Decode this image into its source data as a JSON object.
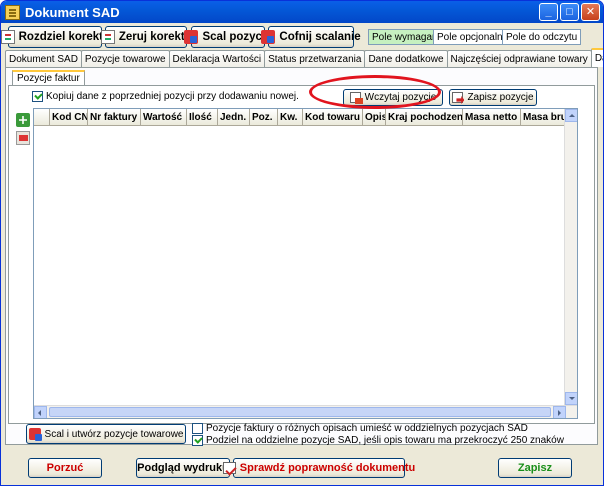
{
  "window": {
    "title": "Dokument SAD"
  },
  "toolbar": {
    "rozdziel": "Rozdziel korektę",
    "zeruj": "Zeruj korekty",
    "scal": "Scal pozycje",
    "cofnij": "Cofnij scalanie"
  },
  "legend": {
    "wymagane": "Pole wymagane",
    "opcjonalne": "Pole opcjonalne",
    "odczytu": "Pole do odczytu"
  },
  "tabs": [
    "Dokument SAD",
    "Pozycje towarowe",
    "Deklaracja Wartości",
    "Status przetwarzania",
    "Dane dodatkowe",
    "Najczęściej odprawiane towary",
    "Dane źródłowe"
  ],
  "subtab": "Pozycje faktur",
  "copy_checkbox": "Kopiuj dane z poprzedniej pozycji przy dodawaniu nowej.",
  "buttons": {
    "wczytaj": "Wczytaj pozycje",
    "zapisz_pozycje": "Zapisz pozycje",
    "scal_utworz": "Scal i utwórz pozycje towarowe",
    "porzuc": "Porzuć",
    "podglad": "Podgląd wydruku",
    "sprawdz": "Sprawdź poprawność dokumentu",
    "zapisz": "Zapisz"
  },
  "grid_columns": [
    "Kod CN",
    "Nr faktury",
    "Wartość",
    "Ilość",
    "Jedn.",
    "Poz.",
    "Kw.",
    "Kod towaru",
    "Opis",
    "Kraj pochodzenia",
    "Masa netto",
    "Masa brutto"
  ],
  "options": {
    "rozne_opisy": "Pozycje faktury o różnych opisach umieść w oddzielnych pozycjach SAD",
    "podzial": "Podziel na oddzielne pozycje SAD, jeśli opis towaru ma przekroczyć 250 znaków"
  },
  "colors": {
    "required_field": "#c6f0c0",
    "accent_red": "#cc0000",
    "save_green": "#1a8f1a"
  }
}
